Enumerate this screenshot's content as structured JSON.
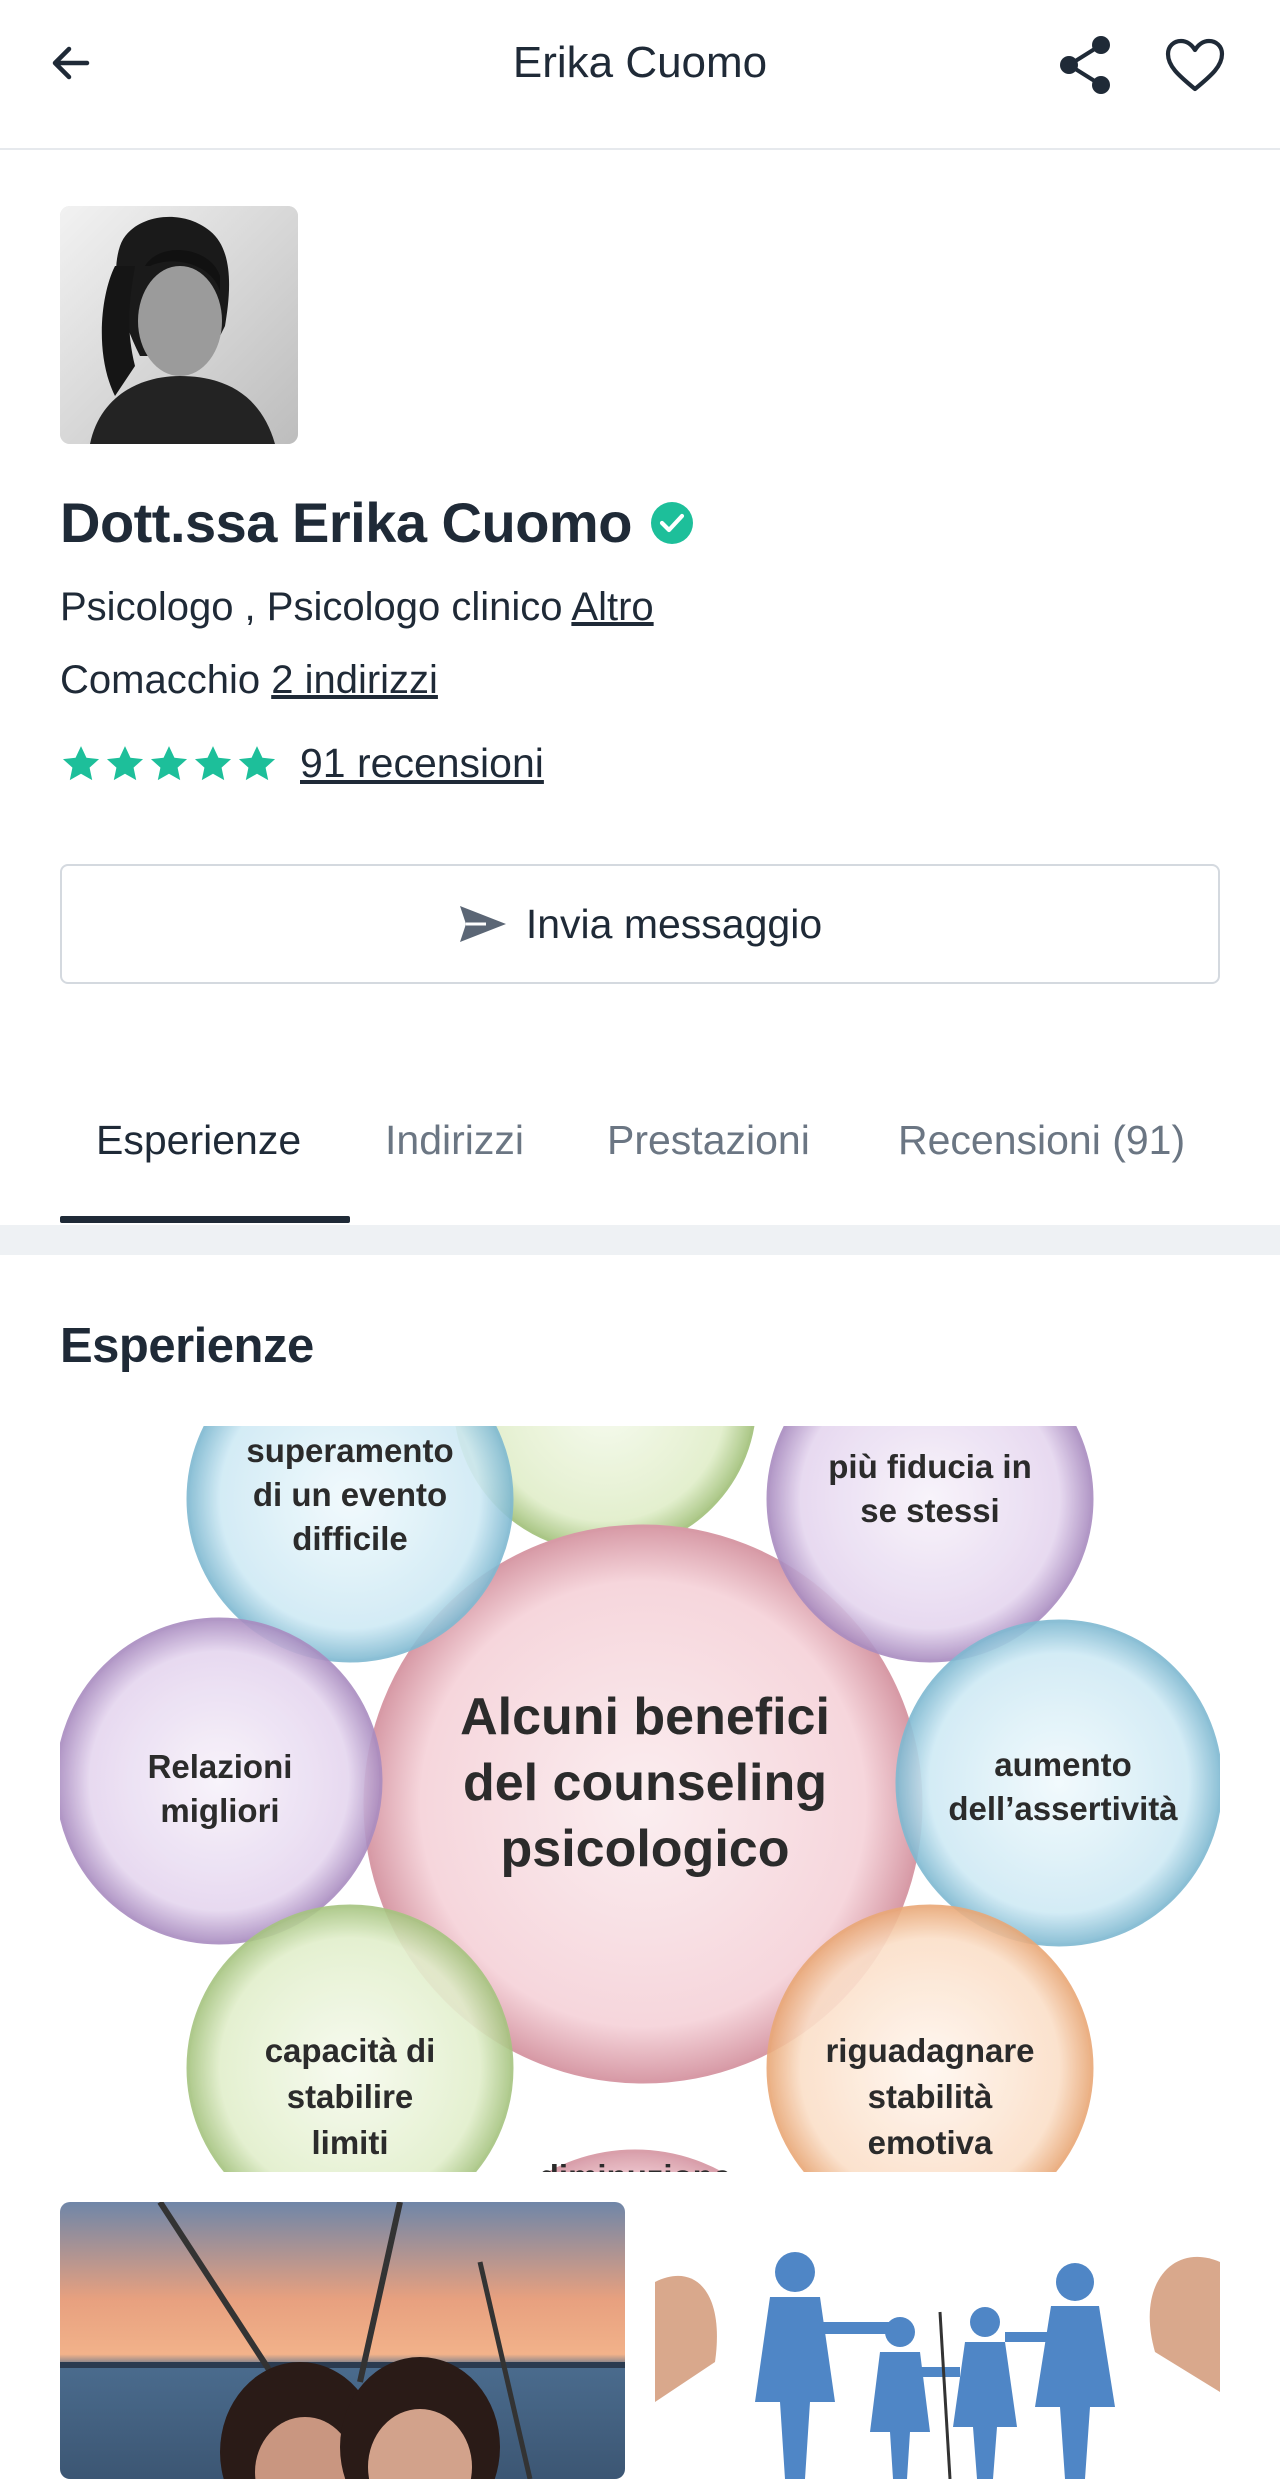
{
  "header": {
    "title": "Erika Cuomo"
  },
  "profile": {
    "name": "Dott.ssa Erika Cuomo",
    "specialties": "Psicologo , Psicologo clinico",
    "specialties_more": "Altro",
    "city": "Comacchio",
    "addresses_link": "2 indirizzi",
    "rating_stars": 5,
    "reviews_link": "91 recensioni"
  },
  "actions": {
    "message_label": "Invia messaggio"
  },
  "tabs": [
    {
      "label": "Esperienze",
      "active": true
    },
    {
      "label": "Indirizzi",
      "active": false
    },
    {
      "label": "Prestazioni",
      "active": false
    },
    {
      "label": "Recensioni (91)",
      "active": false
    }
  ],
  "section": {
    "title": "Esperienze"
  },
  "diagram": {
    "center": [
      "Alcuni benefici",
      "del counseling",
      "psicologico"
    ],
    "bubbles": {
      "top_left": [
        "superamento",
        "di un evento",
        "difficile"
      ],
      "top_right": [
        "più fiducia in",
        "se stessi"
      ],
      "left": [
        "Relazioni",
        "migliori"
      ],
      "right": [
        "aumento",
        "dell’assertività"
      ],
      "bottom_left": [
        "capacità di",
        "stabilire",
        "limiti"
      ],
      "bottom_right": [
        "riguadagnare",
        "stabilità",
        "emotiva"
      ],
      "bottom_center": [
        "diminuzione"
      ]
    }
  },
  "colors": {
    "accent_green": "#1dbf9a",
    "text_dark": "#1f2a37",
    "text_muted": "#6b7683"
  }
}
